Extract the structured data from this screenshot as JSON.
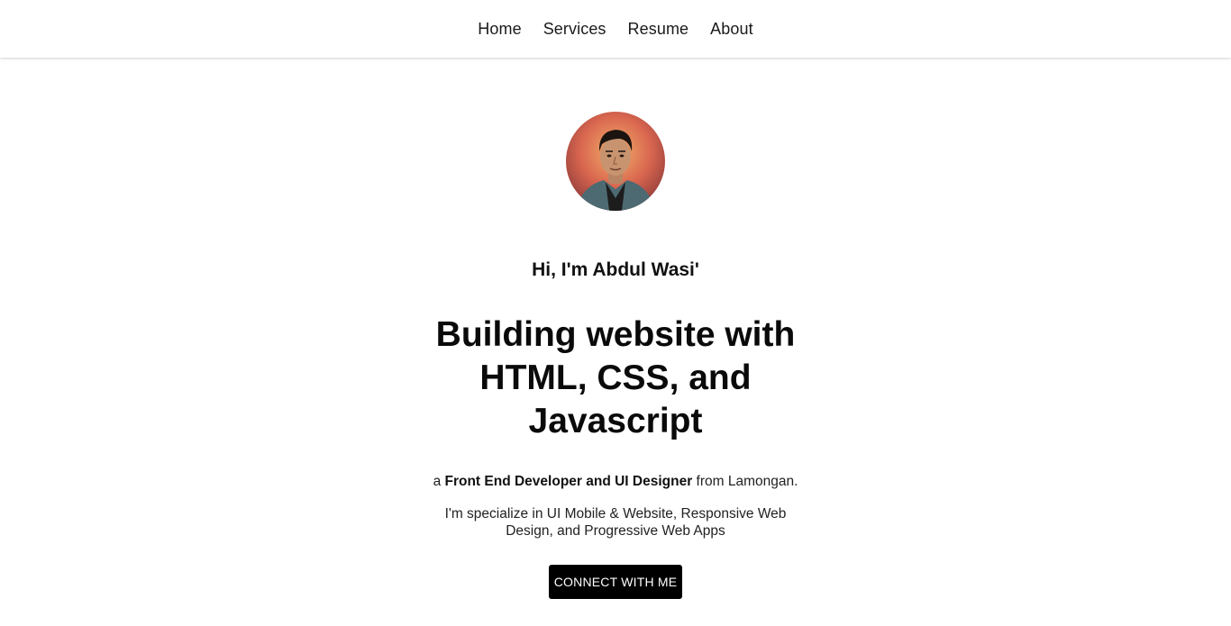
{
  "nav": {
    "items": [
      {
        "label": "Home"
      },
      {
        "label": "Services"
      },
      {
        "label": "Resume"
      },
      {
        "label": "About"
      }
    ]
  },
  "hero": {
    "avatar": {
      "icon": "avatar-portrait"
    },
    "greeting": "Hi, I'm Abdul Wasi'",
    "headline": "Building website with HTML, CSS, and Javascript",
    "role_prefix": "a ",
    "role_bold": "Front End Developer and UI Designer",
    "role_suffix": " from Lamongan.",
    "specialize": "I'm specialize in UI Mobile & Website, Responsive Web Design, and Progressive Web Apps",
    "cta_label": "CONNECT WITH ME"
  },
  "colors": {
    "background": "#ffffff",
    "text": "#111111",
    "button_bg": "#000000",
    "button_text": "#ffffff"
  }
}
